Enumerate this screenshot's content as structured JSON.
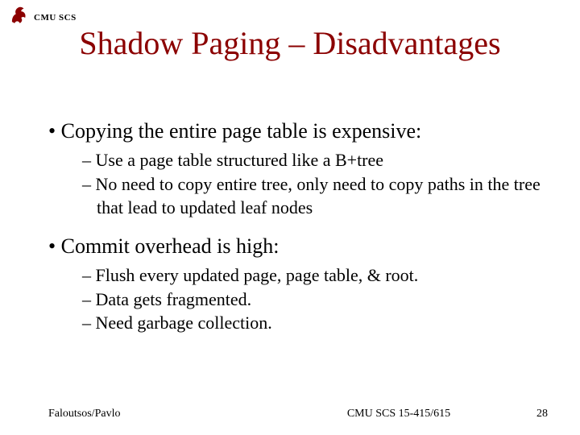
{
  "header": {
    "label": "CMU SCS"
  },
  "title": "Shadow Paging – Disadvantages",
  "bullets": [
    {
      "text": "Copying the entire page table is expensive:",
      "subs": [
        "Use a page table structured like a B+tree",
        "No need to copy entire tree, only need to copy paths in the tree that lead to updated leaf nodes"
      ]
    },
    {
      "text": "Commit overhead is high:",
      "subs": [
        "Flush every updated page,  page table, & root.",
        "Data gets fragmented.",
        "Need garbage collection."
      ]
    }
  ],
  "footer": {
    "left": "Faloutsos/Pavlo",
    "center": "CMU SCS 15-415/615",
    "right": "28"
  }
}
